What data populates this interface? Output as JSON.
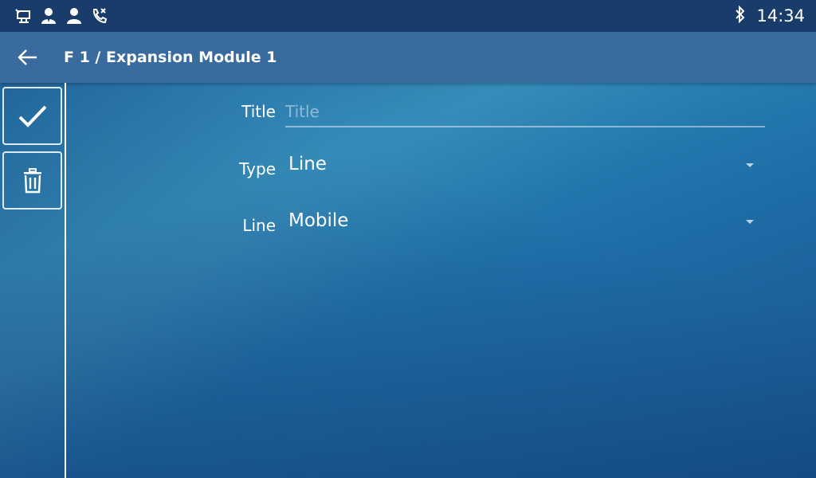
{
  "status_bar": {
    "icons": [
      "network-icon",
      "account-icon",
      "contact-icon",
      "call-forward-icon"
    ],
    "bluetooth_icon": "bluetooth-icon",
    "time": "14:34"
  },
  "header": {
    "back_icon": "arrow-left-icon",
    "title": "F 1 / Expansion Module 1"
  },
  "rail": {
    "save_icon": "checkmark-icon",
    "delete_icon": "trash-icon"
  },
  "form": {
    "title": {
      "label": "Title",
      "value": "",
      "placeholder": "Title"
    },
    "type": {
      "label": "Type",
      "value": "Line"
    },
    "line": {
      "label": "Line",
      "value": "Mobile"
    }
  },
  "colors": {
    "status_bar": "#1a3c6a",
    "title_bar": "#3a6b9f",
    "background_accent": "#2b86b6"
  }
}
